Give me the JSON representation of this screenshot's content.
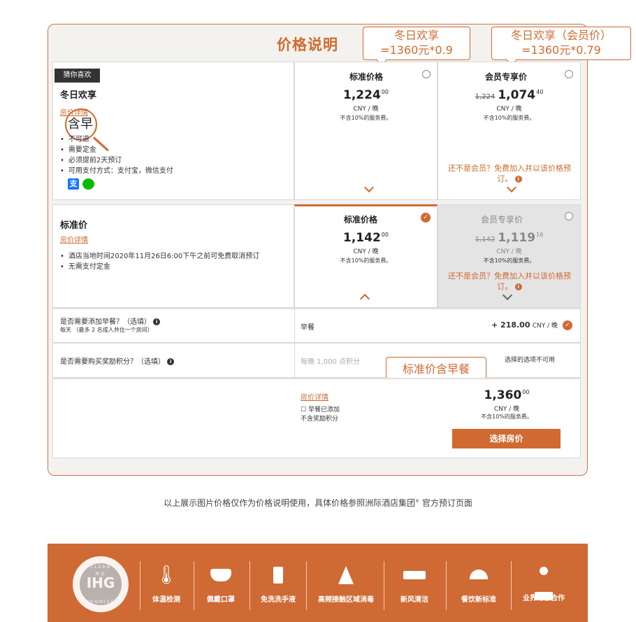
{
  "panel": {
    "title": "价格说明"
  },
  "callouts": {
    "winter": {
      "line1": "冬日欢享",
      "line2": "=1360元*0.9"
    },
    "member": {
      "line1": "冬日欢享（会员价）",
      "line2": "=1360元*0.79"
    },
    "standard_breakfast": "标准价含早餐"
  },
  "rate1": {
    "tag": "猜你喜欢",
    "name": "冬日欢享",
    "details_link": "房价详情",
    "highlight": "含早",
    "bullets": [
      "不可退",
      "需要定金",
      "必须提前2天预订",
      "可用支付方式：支付宝，微信支付"
    ],
    "payment_icons": [
      "alipay-icon",
      "wechat-pay-icon"
    ],
    "standard": {
      "title": "标准价格",
      "price_int": "1,224",
      "price_dec": "00",
      "unit": "CNY / 晚",
      "fee": "不含10%的服务费。"
    },
    "member": {
      "title": "会员专享价",
      "old_price": "1,224",
      "price_int": "1,074",
      "price_dec": "40",
      "unit": "CNY / 晚",
      "fee": "不含10%的服务费。",
      "promo": "还不是会员？免费加入并以该价格预订。"
    }
  },
  "rate2": {
    "name": "标准价",
    "details_link": "房价详情",
    "bullets": [
      "酒店当地时间2020年11月26日6:00下午之前可免费取消预订",
      "无需支付定金"
    ],
    "standard": {
      "title": "标准价格",
      "price_int": "1,142",
      "price_dec": "00",
      "unit": "CNY / 晚",
      "fee": "不含10%的服务费。"
    },
    "member": {
      "title": "会员专享价",
      "old_price": "1,142",
      "price_int": "1,119",
      "price_dec": "16",
      "unit": "CNY / 晚",
      "fee": "不含10%的服务费。",
      "promo": "还不是会员？免费加入并以该价格预订。"
    }
  },
  "addons": {
    "breakfast": {
      "question": "是否需要添加早餐？（选填）",
      "note": "每天 （最多 2 名成人共住一个房间）",
      "option": "早餐",
      "price": "+ 218.00",
      "unit": "CNY / 晚"
    },
    "points": {
      "question": "是否需要购买奖励积分？（选填）",
      "option": "每晚 1,000 点积分",
      "status": "选择的选项不可用"
    }
  },
  "summary": {
    "details_link": "房价详情",
    "line1": "早餐已添加",
    "line2": "不含奖励积分",
    "price_int": "1,360",
    "price_dec": "00",
    "unit": "CNY / 晚",
    "fee": "不含10%的服务费。",
    "button": "选择房价"
  },
  "footnote": {
    "text": "以上展示图片价格仅作为价格说明使用，具体价格参照洲际酒店集团",
    "reg": "®",
    "text2": " 官方预订页面"
  },
  "banner": {
    "seal_top": "CLEAN",
    "seal_main": "IHG",
    "seal_cn": "洲全",
    "seal_bottom": "PROMISE",
    "items": [
      {
        "icon": "thermometer-icon",
        "glyph": "🌡",
        "label": "体温检测"
      },
      {
        "icon": "mask-icon",
        "glyph": "😷",
        "label": "佩戴口罩"
      },
      {
        "icon": "hand-sanitizer-icon",
        "glyph": "🧴",
        "label": "免洗洗手液"
      },
      {
        "icon": "spray-bottle-icon",
        "glyph": "🧪",
        "label": "高频接触区域消毒"
      },
      {
        "icon": "air-conditioner-icon",
        "glyph": "▭",
        "label": "新风清洁"
      },
      {
        "icon": "food-cloche-icon",
        "glyph": "🍽",
        "label": "餐饮新标准"
      },
      {
        "icon": "expert-icon",
        "glyph": "👤",
        "label": "业界专家合作"
      }
    ]
  },
  "colors": {
    "accent": "#d06a31",
    "banner": "#cf6a34",
    "panel_bg": "#f3f2ee"
  }
}
